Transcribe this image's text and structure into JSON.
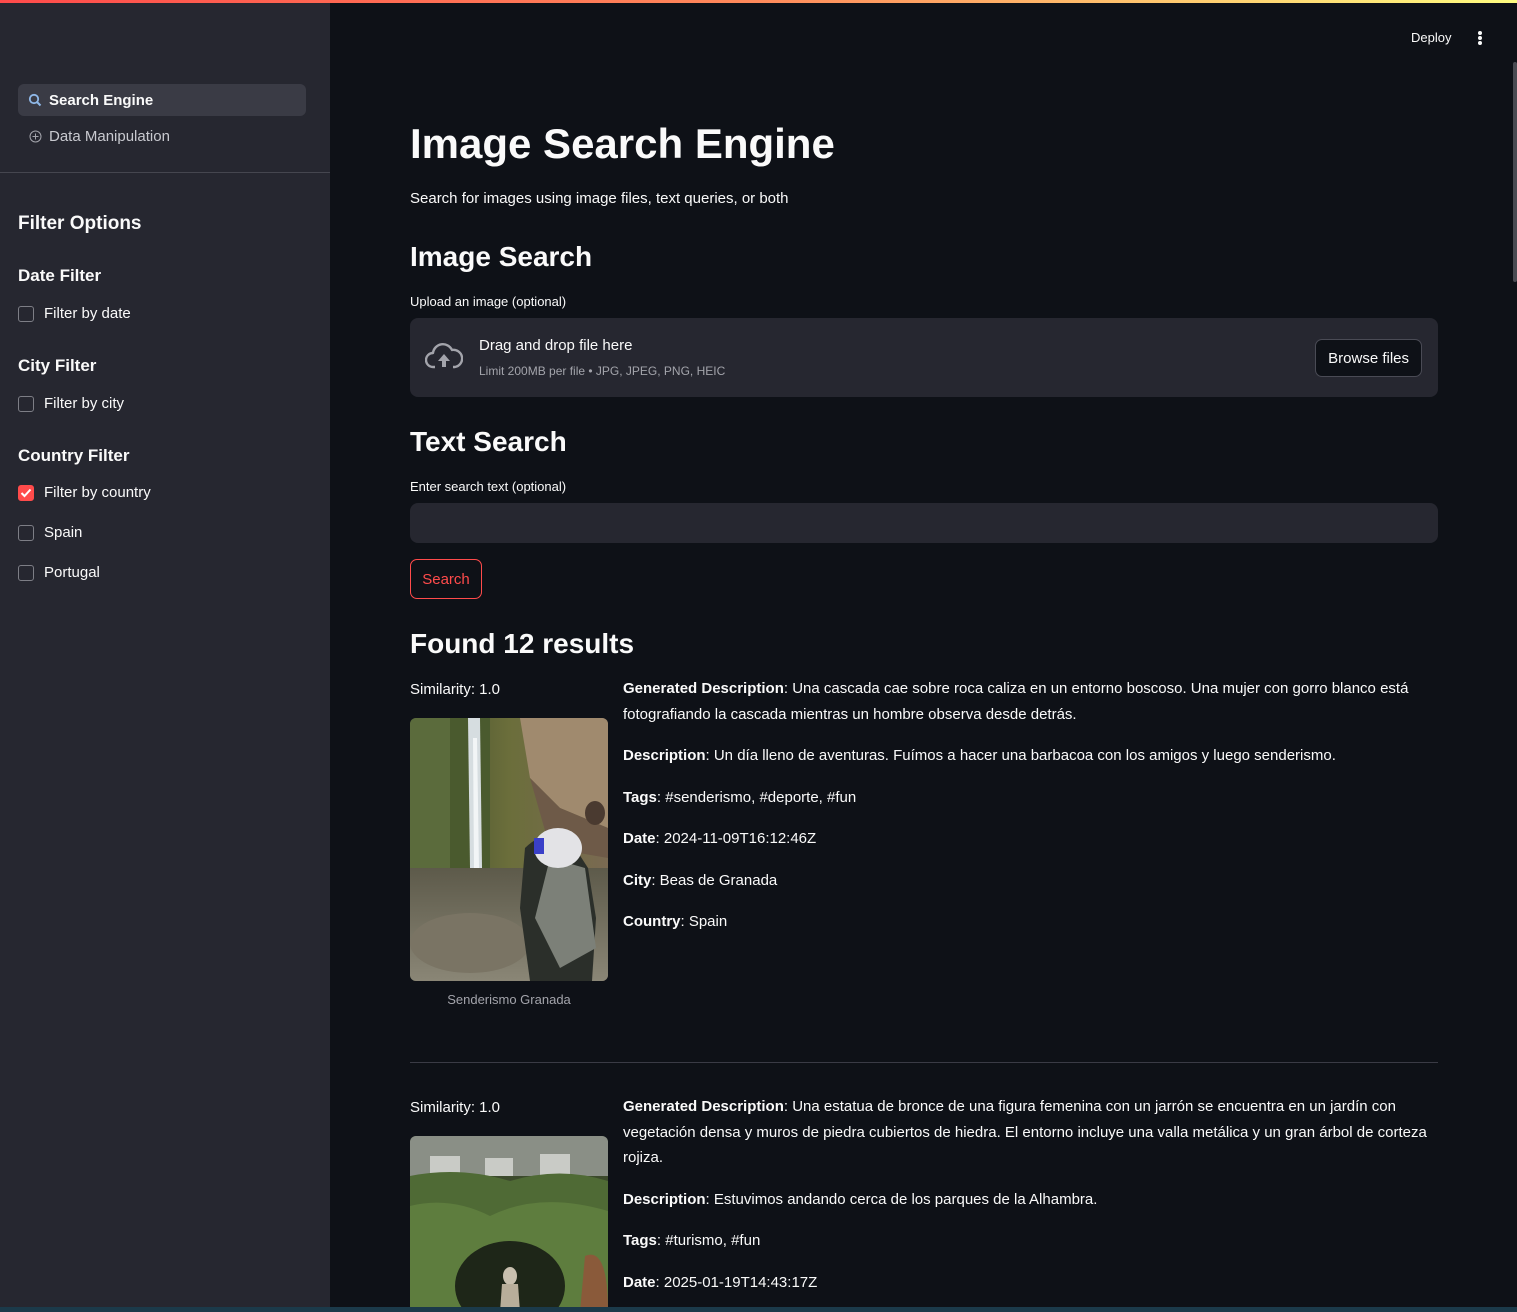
{
  "header": {
    "deploy_label": "Deploy"
  },
  "sidebar": {
    "nav": [
      {
        "label": "Search Engine",
        "icon": "search-icon",
        "active": true
      },
      {
        "label": "Data Manipulation",
        "icon": "plus-circle-icon",
        "active": false
      }
    ],
    "filter_title": "Filter Options",
    "date_filter": {
      "title": "Date Filter",
      "checkbox_label": "Filter by date",
      "checked": false
    },
    "city_filter": {
      "title": "City Filter",
      "checkbox_label": "Filter by city",
      "checked": false
    },
    "country_filter": {
      "title": "Country Filter",
      "checkbox_label": "Filter by country",
      "checked": true,
      "options": [
        {
          "label": "Spain",
          "checked": false
        },
        {
          "label": "Portugal",
          "checked": false
        }
      ]
    }
  },
  "main": {
    "title": "Image Search Engine",
    "caption": "Search for images using image files, text queries, or both",
    "image_search": {
      "title": "Image Search",
      "upload_label": "Upload an image (optional)",
      "drop_text": "Drag and drop file here",
      "limit_text": "Limit 200MB per file • JPG, JPEG, PNG, HEIC",
      "browse_label": "Browse files"
    },
    "text_search": {
      "title": "Text Search",
      "input_label": "Enter search text (optional)",
      "input_value": "",
      "button_label": "Search"
    },
    "results_title": "Found 12 results",
    "results": [
      {
        "similarity": "Similarity: 1.0",
        "caption": "Senderismo Granada",
        "fields": {
          "generated_description": {
            "label": "Generated Description",
            "value": ": Una cascada cae sobre roca caliza en un entorno boscoso. Una mujer con gorro blanco está fotografiando la cascada mientras un hombre observa desde detrás."
          },
          "description": {
            "label": "Description",
            "value": ": Un día lleno de aventuras. Fuímos a hacer una barbacoa con los amigos y luego senderismo."
          },
          "tags": {
            "label": "Tags",
            "value": ": #senderismo, #deporte, #fun"
          },
          "date": {
            "label": "Date",
            "value": ": 2024-11-09T16:12:46Z"
          },
          "city": {
            "label": "City",
            "value": ": Beas de Granada"
          },
          "country": {
            "label": "Country",
            "value": ": Spain"
          }
        }
      },
      {
        "similarity": "Similarity: 1.0",
        "fields": {
          "generated_description": {
            "label": "Generated Description",
            "value": ": Una estatua de bronce de una figura femenina con un jarrón se encuentra en un jardín con vegetación densa y muros de piedra cubiertos de hiedra. El entorno incluye una valla metálica y un gran árbol de corteza rojiza."
          },
          "description": {
            "label": "Description",
            "value": ": Estuvimos andando cerca de los parques de la Alhambra."
          },
          "tags": {
            "label": "Tags",
            "value": ": #turismo, #fun"
          },
          "date": {
            "label": "Date",
            "value": ": 2025-01-19T14:43:17Z"
          }
        }
      }
    ]
  },
  "colors": {
    "accent": "#ff4b4b",
    "background": "#0e1117",
    "sidebar": "#262730"
  }
}
